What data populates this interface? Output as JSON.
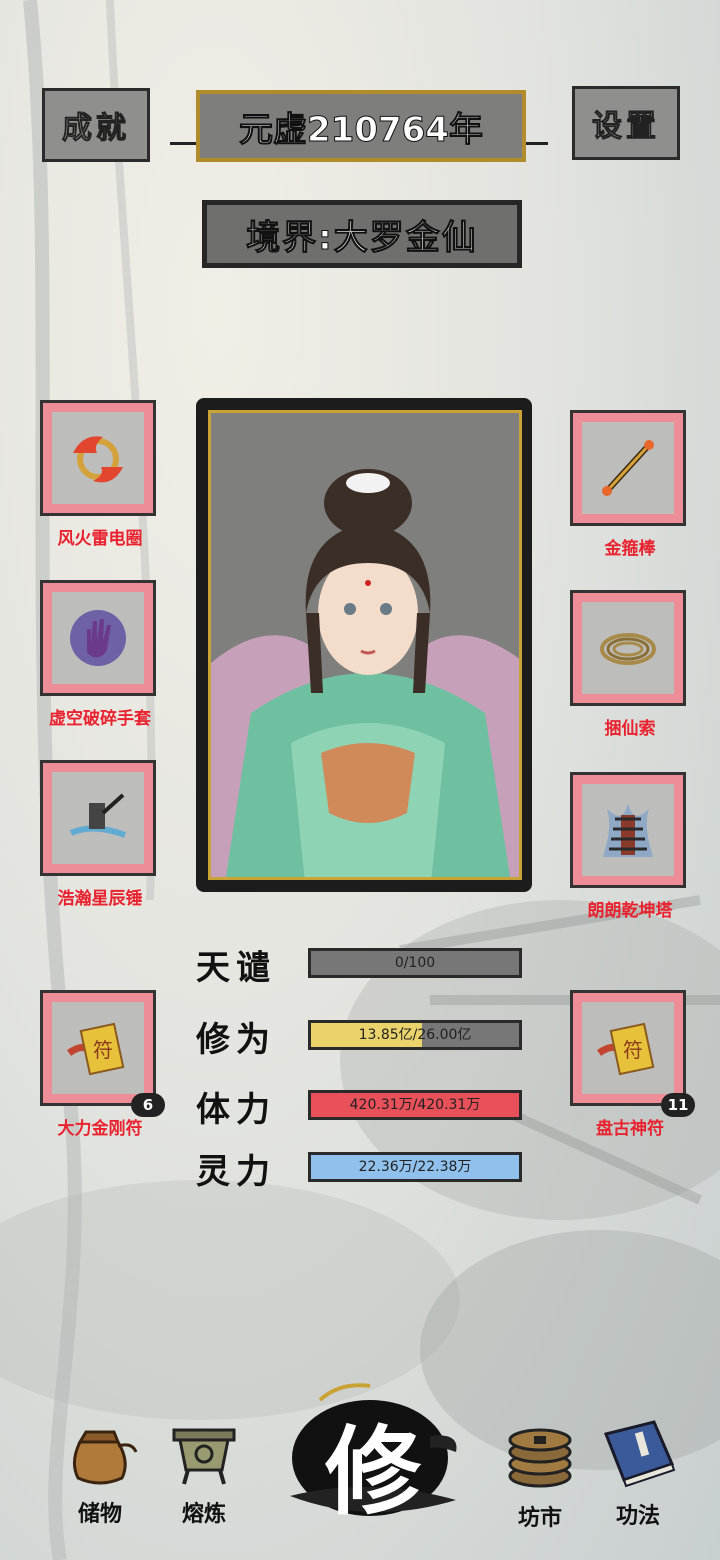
{
  "header": {
    "achievements_label": "成就",
    "year_label": "元虚210764年",
    "settings_label": "设置",
    "realm_label": "境界:大罗金仙"
  },
  "left_items": [
    {
      "label": "风火雷电圈",
      "icon": "fire-ring-icon"
    },
    {
      "label": "虚空破碎手套",
      "icon": "void-glove-icon"
    },
    {
      "label": "浩瀚星辰锤",
      "icon": "star-hammer-icon"
    },
    {
      "label": "大力金刚符",
      "icon": "talisman-icon",
      "count": "6"
    }
  ],
  "right_items": [
    {
      "label": "金箍棒",
      "icon": "golden-staff-icon"
    },
    {
      "label": "捆仙索",
      "icon": "rope-icon"
    },
    {
      "label": "朗朗乾坤塔",
      "icon": "pagoda-icon"
    },
    {
      "label": "盘古神符",
      "icon": "talisman-icon",
      "count": "11"
    }
  ],
  "stats": [
    {
      "name": "天谴",
      "value": "0/100",
      "fraction": 0.0,
      "color": "#8a8a88"
    },
    {
      "name": "修为",
      "value": "13.85亿/26.00亿",
      "fraction": 0.533,
      "color": "#e9d36a"
    },
    {
      "name": "体力",
      "value": "420.31万/420.31万",
      "fraction": 1.0,
      "color": "#e8505a"
    },
    {
      "name": "灵力",
      "value": "22.36万/22.38万",
      "fraction": 0.999,
      "color": "#8fc1ec"
    }
  ],
  "nav": {
    "storage": "储物",
    "refine": "熔炼",
    "cultivate": "修",
    "market": "坊市",
    "techniques": "功法"
  }
}
